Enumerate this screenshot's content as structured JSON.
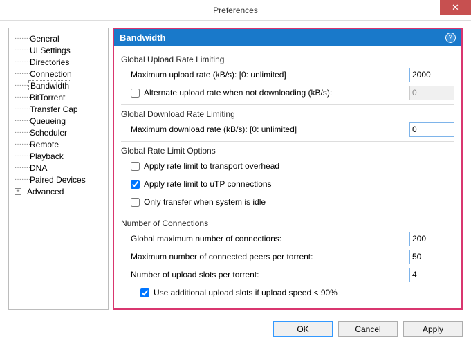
{
  "window": {
    "title": "Preferences"
  },
  "tree": {
    "items": [
      {
        "label": "General"
      },
      {
        "label": "UI Settings"
      },
      {
        "label": "Directories"
      },
      {
        "label": "Connection"
      },
      {
        "label": "Bandwidth",
        "selected": true
      },
      {
        "label": "BitTorrent"
      },
      {
        "label": "Transfer Cap"
      },
      {
        "label": "Queueing"
      },
      {
        "label": "Scheduler"
      },
      {
        "label": "Remote"
      },
      {
        "label": "Playback"
      },
      {
        "label": "DNA"
      },
      {
        "label": "Paired Devices"
      },
      {
        "label": "Advanced",
        "expandable": true
      }
    ]
  },
  "panel": {
    "title": "Bandwidth",
    "upload": {
      "section": "Global Upload Rate Limiting",
      "max_label": "Maximum upload rate (kB/s): [0: unlimited]",
      "max_value": "2000",
      "alt_label": "Alternate upload rate when not downloading (kB/s):",
      "alt_value": "0",
      "alt_checked": false
    },
    "download": {
      "section": "Global Download Rate Limiting",
      "max_label": "Maximum download rate (kB/s): [0: unlimited]",
      "max_value": "0"
    },
    "options": {
      "section": "Global Rate Limit Options",
      "overhead_label": "Apply rate limit to transport overhead",
      "overhead_checked": false,
      "utp_label": "Apply rate limit to uTP connections",
      "utp_checked": true,
      "idle_label": "Only transfer when system is idle",
      "idle_checked": false
    },
    "connections": {
      "section": "Number of Connections",
      "global_label": "Global maximum number of connections:",
      "global_value": "200",
      "peers_label": "Maximum number of connected peers per torrent:",
      "peers_value": "50",
      "slots_label": "Number of upload slots per torrent:",
      "slots_value": "4",
      "extra_label": "Use additional upload slots if upload speed < 90%",
      "extra_checked": true
    }
  },
  "buttons": {
    "ok": "OK",
    "cancel": "Cancel",
    "apply": "Apply"
  }
}
